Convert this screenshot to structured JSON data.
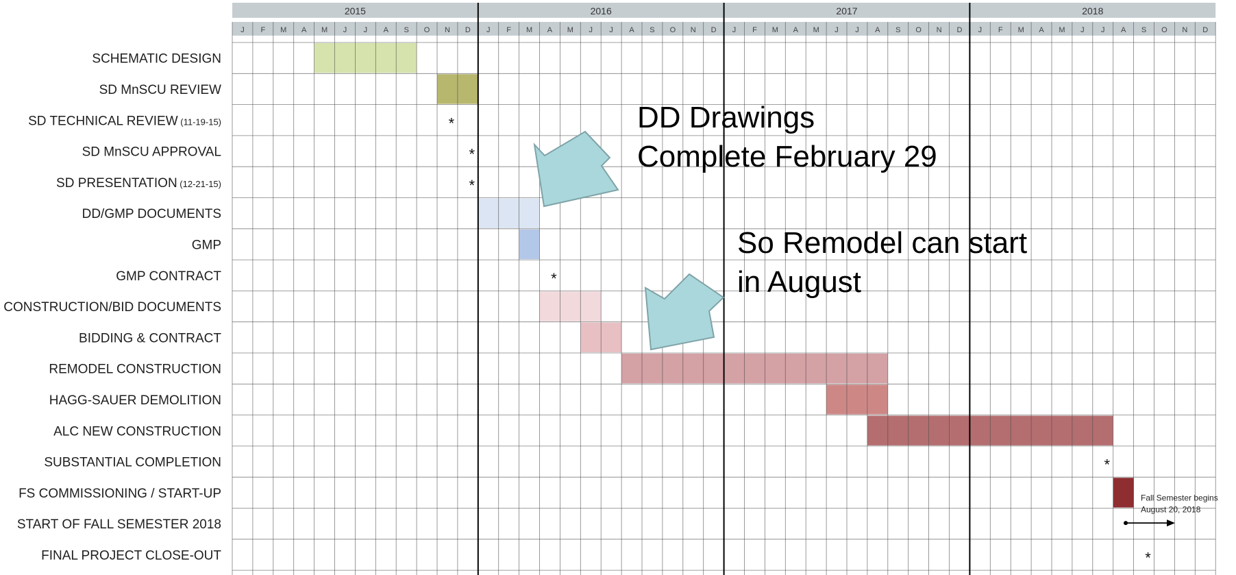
{
  "chart_data": {
    "type": "gantt",
    "years": [
      "2015",
      "2016",
      "2017",
      "2018"
    ],
    "months": [
      "J",
      "F",
      "M",
      "A",
      "M",
      "J",
      "J",
      "A",
      "S",
      "O",
      "N",
      "D"
    ],
    "tasks": [
      {
        "label": "SCHEMATIC DESIGN",
        "date_note": "",
        "start": "2015-05",
        "end": "2015-09",
        "kind": "bar",
        "color": "#d6e3ac"
      },
      {
        "label": "SD MnSCU REVIEW",
        "date_note": "",
        "start": "2015-11",
        "end": "2015-12",
        "kind": "bar",
        "color": "#b8b76e"
      },
      {
        "label": "SD TECHNICAL REVIEW",
        "date_note": "(11-19-15)",
        "date": "2015-11",
        "kind": "milestone"
      },
      {
        "label": "SD MnSCU APPROVAL",
        "date_note": "",
        "date": "2015-12",
        "kind": "milestone"
      },
      {
        "label": "SD PRESENTATION",
        "date_note": "(12-21-15)",
        "date": "2015-12",
        "kind": "milestone"
      },
      {
        "label": "DD/GMP DOCUMENTS",
        "date_note": "",
        "start": "2016-01",
        "end": "2016-03",
        "kind": "bar",
        "color": "#dbe5f3"
      },
      {
        "label": "GMP",
        "date_note": "",
        "start": "2016-03",
        "end": "2016-03",
        "kind": "bar",
        "color": "#b3c7e8"
      },
      {
        "label": "GMP CONTRACT",
        "date_note": "",
        "date": "2016-04",
        "kind": "milestone"
      },
      {
        "label": "CONSTRUCTION/BID DOCUMENTS",
        "date_note": "",
        "start": "2016-04",
        "end": "2016-06",
        "kind": "bar",
        "color": "#f2d9dc"
      },
      {
        "label": "BIDDING & CONTRACT",
        "date_note": "",
        "start": "2016-06",
        "end": "2016-07",
        "kind": "bar",
        "color": "#e8c0c3"
      },
      {
        "label": "REMODEL CONSTRUCTION",
        "date_note": "",
        "start": "2016-08",
        "end": "2017-08",
        "kind": "bar",
        "color": "#d4a1a5"
      },
      {
        "label": "HAGG-SAUER DEMOLITION",
        "date_note": "",
        "start": "2017-06",
        "end": "2017-08",
        "kind": "bar",
        "color": "#cd8886"
      },
      {
        "label": "ALC NEW CONSTRUCTION",
        "date_note": "",
        "start": "2017-08",
        "end": "2018-07",
        "kind": "bar",
        "color": "#b46e70"
      },
      {
        "label": "SUBSTANTIAL COMPLETION",
        "date_note": "",
        "date": "2018-07",
        "kind": "milestone"
      },
      {
        "label": "FS COMMISSIONING / START-UP",
        "date_note": "",
        "start": "2018-08",
        "end": "2018-08",
        "kind": "bar",
        "color": "#8e2e31"
      },
      {
        "label": "START OF FALL SEMESTER 2018",
        "date_note": "",
        "date": "2018-08-20",
        "kind": "arrow"
      },
      {
        "label": "FINAL PROJECT CLOSE-OUT",
        "date_note": "",
        "date": "2018-09",
        "kind": "milestone"
      }
    ],
    "notes": [
      {
        "text": "Fall Semester begins",
        "row": 15
      },
      {
        "text": "August 20, 2018",
        "row": 15
      }
    ],
    "milestone_symbol": "*",
    "colors": {
      "header_band": "#c5cdd1",
      "grid": "#4a4a4a",
      "year_divider": "#000000",
      "callout_arrow_fill": "#a9d7db",
      "callout_arrow_stroke": "#7fa3a8"
    }
  },
  "callouts": [
    {
      "lines": [
        "DD Drawings",
        "Complete February 29"
      ]
    },
    {
      "lines": [
        "So Remodel can start",
        "in August"
      ]
    }
  ]
}
